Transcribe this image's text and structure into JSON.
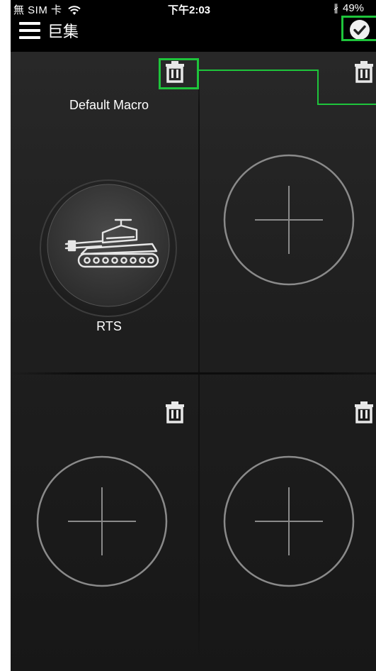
{
  "status_bar": {
    "carrier": "無 SIM 卡",
    "time": "下午2:03",
    "battery": "49%"
  },
  "header": {
    "title": "巨集"
  },
  "macros": [
    {
      "slot": 1,
      "name": "Default Macro",
      "label": "RTS",
      "icon": "tank-icon"
    }
  ],
  "empty_slots": [
    2,
    3,
    4
  ],
  "colors": {
    "highlight": "#1ec43b",
    "background": "#1f1f1f",
    "topbar": "#000000",
    "text": "#ffffff"
  }
}
